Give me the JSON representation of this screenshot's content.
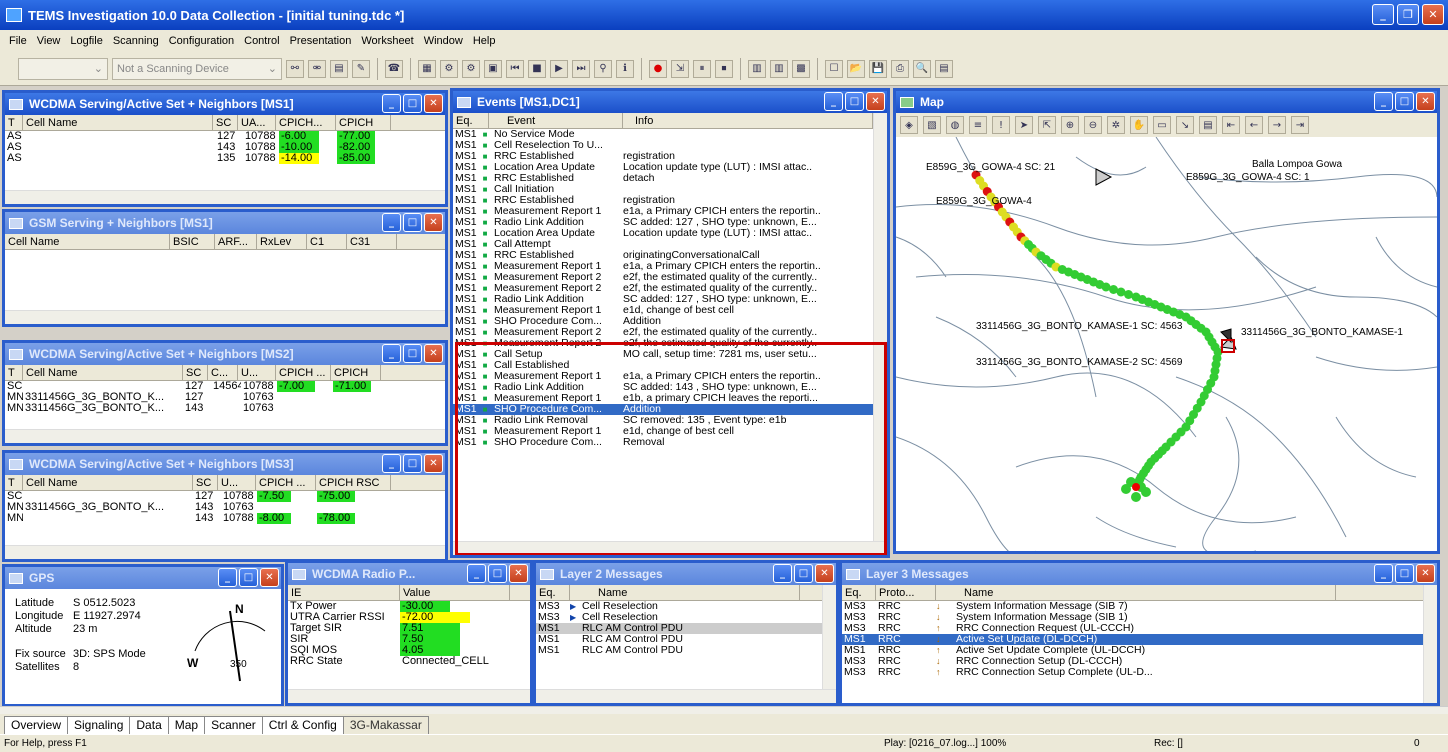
{
  "app": {
    "title": "TEMS Investigation 10.0 Data Collection - [initial tuning.tdc *]"
  },
  "menu": [
    "File",
    "View",
    "Logfile",
    "Scanning",
    "Configuration",
    "Control",
    "Presentation",
    "Worksheet",
    "Window",
    "Help"
  ],
  "toolbar": {
    "combo1": "",
    "combo2": "Not a Scanning Device"
  },
  "ws1": {
    "title": "WCDMA Serving/Active Set + Neighbors [MS1]",
    "headers": [
      "T",
      "Cell Name",
      "SC",
      "UA...",
      "CPICH...",
      "CPICH"
    ],
    "rows": [
      [
        "AS",
        "",
        "127",
        "10788",
        "-6.00",
        "-77.00"
      ],
      [
        "AS",
        "",
        "143",
        "10788",
        "-10.00",
        "-82.00"
      ],
      [
        "AS",
        "",
        "135",
        "10788",
        "-14.00",
        "-85.00"
      ]
    ]
  },
  "gsm": {
    "title": "GSM Serving + Neighbors [MS1]",
    "headers": [
      "Cell Name",
      "BSIC",
      "ARF...",
      "RxLev",
      "C1",
      "C31"
    ]
  },
  "ws2": {
    "title": "WCDMA Serving/Active Set + Neighbors [MS2]",
    "headers": [
      "T",
      "Cell Name",
      "SC",
      "C...",
      "U...",
      "CPICH ...",
      "CPICH"
    ],
    "rows": [
      [
        "SC",
        "",
        "127",
        "14564",
        "10788",
        "-7.00",
        "-71.00"
      ],
      [
        "MN",
        "3311456G_3G_BONTO_K...",
        "127",
        "",
        "10763",
        "",
        ""
      ],
      [
        "MN",
        "3311456G_3G_BONTO_K...",
        "143",
        "",
        "10763",
        "",
        ""
      ]
    ]
  },
  "ws3": {
    "title": "WCDMA Serving/Active Set + Neighbors [MS3]",
    "headers": [
      "T",
      "Cell Name",
      "SC",
      "U...",
      "CPICH ...",
      "CPICH RSC"
    ],
    "rows": [
      [
        "SC",
        "",
        "127",
        "10788",
        "-7.50",
        "-75.00"
      ],
      [
        "MN",
        "3311456G_3G_BONTO_K...",
        "143",
        "10763",
        "",
        ""
      ],
      [
        "MN",
        "",
        "143",
        "10788",
        "-8.00",
        "-78.00"
      ]
    ]
  },
  "events": {
    "title": "Events [MS1,DC1]",
    "headers": [
      "Eq.",
      "Event",
      "Info"
    ],
    "rows": [
      [
        "MS1",
        "No Service Mode",
        ""
      ],
      [
        "MS1",
        "Cell Reselection To U...",
        ""
      ],
      [
        "MS1",
        "RRC Established",
        "registration"
      ],
      [
        "MS1",
        "Location Area Update",
        "Location update type (LUT) : IMSI attac.."
      ],
      [
        "MS1",
        "RRC Established",
        "detach"
      ],
      [
        "MS1",
        "Call Initiation",
        ""
      ],
      [
        "MS1",
        "RRC Established",
        "registration"
      ],
      [
        "MS1",
        "Measurement Report 1",
        "e1a, a Primary CPICH enters the reportin.."
      ],
      [
        "MS1",
        "Radio Link Addition",
        "SC added: 127 , SHO type: unknown, E..."
      ],
      [
        "MS1",
        "Location Area Update",
        "Location update type (LUT) : IMSI attac.."
      ],
      [
        "MS1",
        "Call Attempt",
        ""
      ],
      [
        "MS1",
        "RRC Established",
        "originatingConversationalCall"
      ],
      [
        "MS1",
        "Measurement Report 1",
        "e1a, a Primary CPICH enters the reportin.."
      ],
      [
        "MS1",
        "Measurement Report 2",
        "e2f, the estimated quality of the currently.."
      ],
      [
        "MS1",
        "Measurement Report 2",
        "e2f, the estimated quality of the currently.."
      ],
      [
        "MS1",
        "Radio Link Addition",
        "SC added: 127 , SHO type: unknown, E..."
      ],
      [
        "MS1",
        "Measurement Report 1",
        "e1d, change of best cell"
      ],
      [
        "MS1",
        "SHO Procedure Com...",
        "Addition"
      ],
      [
        "MS1",
        "Measurement Report 2",
        "e2f, the estimated quality of the currently.."
      ],
      [
        "MS1",
        "Measurement Report 2",
        "e2f, the estimated quality of the currently.."
      ],
      [
        "MS1",
        "Call Setup",
        "MO call, setup time: 7281 ms, user setu..."
      ],
      [
        "MS1",
        "Call Established",
        ""
      ],
      [
        "MS1",
        "Measurement Report 1",
        "e1a, a Primary CPICH enters the reportin.."
      ],
      [
        "MS1",
        "Radio Link Addition",
        "SC added: 143 , SHO type: unknown, E..."
      ],
      [
        "MS1",
        "Measurement Report 1",
        "e1b, a primary CPICH leaves the reporti..."
      ],
      [
        "MS1",
        "SHO Procedure Com...",
        "Addition"
      ],
      [
        "MS1",
        "Radio Link Removal",
        "SC removed: 135 , Event type: e1b"
      ],
      [
        "MS1",
        "Measurement Report 1",
        "e1d, change of best cell"
      ],
      [
        "MS1",
        "SHO Procedure Com...",
        "Removal"
      ]
    ]
  },
  "map": {
    "title": "Map",
    "labels": [
      "E859G_3G_GOWA-4 SC: 21",
      "Balla Lompoa Gowa",
      "E859G_3G_GOWA-4 SC: 1",
      "E859G_3G_GOWA-4",
      "3311456G_3G_BONTO_KAMASE-1 SC: 4563",
      "3311456G_3G_BONTO_KAMASE-1",
      "3311456G_3G_BONTO_KAMASE-2 SC: 4569"
    ]
  },
  "gps": {
    "title": "GPS",
    "latitude_label": "Latitude",
    "latitude": "S 0512.5023",
    "longitude_label": "Longitude",
    "longitude": "E 11927.2974",
    "altitude_label": "Altitude",
    "altitude": "23 m",
    "fix_label": "Fix source",
    "fix": "3D: SPS Mode",
    "sat_label": "Satellites",
    "sat": "8",
    "compass_n": "N",
    "compass_w": "W",
    "heading": "350"
  },
  "radio": {
    "title": "WCDMA Radio P...",
    "headers": [
      "IE",
      "Value"
    ],
    "rows": [
      [
        "Tx Power",
        "-30.00"
      ],
      [
        "UTRA Carrier RSSI",
        "-72.00"
      ],
      [
        "Target SIR",
        "7.51"
      ],
      [
        "SIR",
        "7.50"
      ],
      [
        "SQI MOS",
        "4.05"
      ],
      [
        "RRC State",
        "Connected_CELL"
      ]
    ]
  },
  "l2": {
    "title": "Layer 2 Messages",
    "headers": [
      "Eq.",
      "Name"
    ],
    "rows": [
      [
        "MS3",
        "Cell Reselection"
      ],
      [
        "MS3",
        "Cell Reselection"
      ],
      [
        "MS1",
        "RLC AM Control PDU"
      ],
      [
        "MS1",
        "RLC AM Control PDU"
      ],
      [
        "MS1",
        "RLC AM Control PDU"
      ]
    ]
  },
  "l3": {
    "title": "Layer 3 Messages",
    "headers": [
      "Eq.",
      "Proto...",
      "Name"
    ],
    "rows": [
      [
        "MS3",
        "RRC",
        "System Information Message (SIB 7)"
      ],
      [
        "MS3",
        "RRC",
        "System Information Message (SIB 1)"
      ],
      [
        "MS3",
        "RRC",
        "RRC Connection Request (UL-CCCH)"
      ],
      [
        "MS1",
        "RRC",
        "Active Set Update (DL-DCCH)"
      ],
      [
        "MS1",
        "RRC",
        "Active Set Update Complete (UL-DCCH)"
      ],
      [
        "MS3",
        "RRC",
        "RRC Connection Setup (DL-CCCH)"
      ],
      [
        "MS3",
        "RRC",
        "RRC Connection Setup Complete (UL-D..."
      ]
    ]
  },
  "tabs": [
    "Overview",
    "Signaling",
    "Data",
    "Map",
    "Scanner",
    "Ctrl & Config",
    "3G-Makassar"
  ],
  "status": {
    "help": "For Help, press F1",
    "play": "Play: [0216_07.log...] 100%",
    "rec": "Rec: []",
    "num": "0"
  },
  "colors": {
    "titlebar": "#0a3fbf",
    "good": "#22dd22",
    "warn": "#ffff00",
    "highlight": "#cc0000",
    "selection": "#316ac5"
  }
}
